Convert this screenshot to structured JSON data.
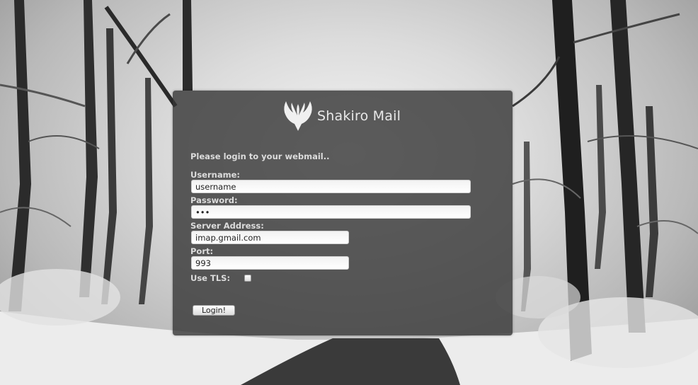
{
  "brand": {
    "name": "Shakiro Mail",
    "logo_icon": "wings-logo-icon"
  },
  "login_form": {
    "intro": "Please login to your webmail..",
    "username": {
      "label": "Username:",
      "value": "username"
    },
    "password": {
      "label": "Password:",
      "value": "•••"
    },
    "server_address": {
      "label": "Server Address:",
      "value": "imap.gmail.com"
    },
    "port": {
      "label": "Port:",
      "value": "993"
    },
    "use_tls": {
      "label": "Use TLS:",
      "checked": false
    },
    "submit_label": "Login!"
  },
  "colors": {
    "panel": "#343434",
    "label_text": "#dcdcdc",
    "logo_text": "#e8e8e8"
  }
}
